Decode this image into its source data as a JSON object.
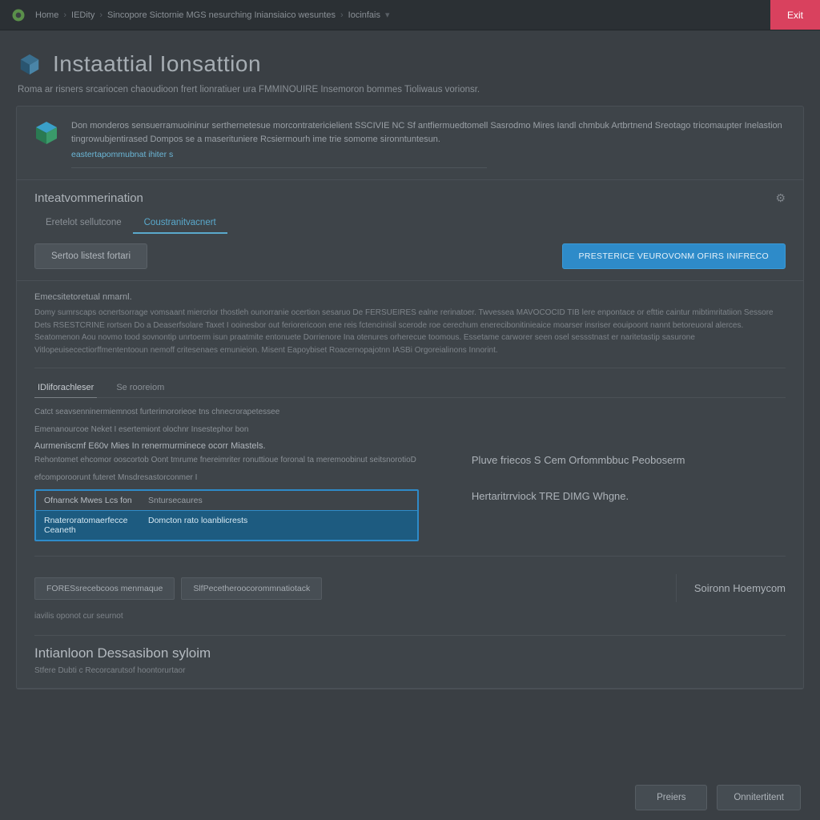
{
  "topbar": {
    "breadcrumb": [
      "Home",
      "IEDity",
      "Sincopore Sictornie MGS nesurching Iniansiaico wesuntes",
      "Iocinfais"
    ],
    "exit_label": "Exit"
  },
  "header": {
    "title": "Instaattial Ionsattion",
    "subtitle": "Roma ar risners srcariocen chaoudioon frert lionratiuer ura FMMINOUIRE Insemoron bommes Tioliwaus vorionsr."
  },
  "notice": {
    "line1": "Don monderos sensuerramuoininur serthernetesue morcontratericielient SSCIVIE NC Sf antfiermuedtomell Sasrodmo Mires Iandl chmbuk Artbrtnend Sreotago tricomaupter Inelastion tingrowubjentirased Dompos se a maserituniere Rcsiermourh ime trie somome sironntuntesun.",
    "link": "eastertapommubnat ihiter s"
  },
  "reco": {
    "title": "Inteatvommerination",
    "tab_inactive": "Eretelot sellutcone",
    "tab_active": "Coustranitvacnert",
    "gear": "⚙",
    "btn_secondary": "Sertoo listest fortari",
    "btn_primary": "PRESTERICE VEUROVONM OFIRS INIFRECO"
  },
  "desc": {
    "title": "Emecsitetoretual nmarnl.",
    "body": "Domy sumrscaps ocnertsorrage vomsaant miercrior thostleh ounorranie ocertion sesaruo De FERSUEIRES ealne rerinatoer. Twvessea MAVOCOCID TIB lere enpontace or efttie caintur mibtimritatiion Sessore Dets RSESTCRINE rortsen Do a Deaserfsolare Taxet I ooinesbor out feriorericoon ene reis fctencinisil scerode roe cerechum enerecibonitinieaice moarser insriser eouipoont nannt betoreuoral alerces. Seatomenon Aou novmo tood sovnontip unrtoerm isun praatmite entonuete Dorrienore Ina otenures orherecue toomous. Essetame carworer seen osel sessstnast er naritetastip sasurone Vitlopeuisecectiorffmententooun nemoff critesenaes emunieion. Misent Eapoybiset Roacernopajotnn IASBi Orgoreialinons Innorint."
  },
  "subtabs": {
    "active": "IDliforachleser",
    "inactive": "Se rooreiom"
  },
  "meta": {
    "line1": "Catct seavsenninermiemnost furterimororieoe tns chnecrorapetessee",
    "line2": "Emenanourcoe Neket I esertemiont olochnr Insestephor bon",
    "heading": "Aurmeniscmf E60v Mies In renermurminece ocorr Miastels.",
    "line3": "Rehontomet ehcomor ooscortob Oont tmrume fnereimriter ronuttioue foronal ta meremoobinut seitsnorotioD",
    "line4": "efcomporoorunt   futeret Mnsdresastorconmer I"
  },
  "select_table": {
    "rows": [
      {
        "c1": "Ofnarnck Mwes Lcs fon",
        "c2": "Sntursecaures",
        "selected": false
      },
      {
        "c1": "Rnateroratomaerfecce Ceaneth",
        "c2": "Domcton rato loanblicrests",
        "selected": true
      }
    ]
  },
  "right_links": {
    "link1": "Pluve friecos S Cem Orfommbbuc Peoboserm",
    "link2": "Hertaritrrviock TRE DIMG Whgne."
  },
  "chips": {
    "chip1": "FORESsrecebcoos menmaque",
    "chip2": "SlfPecetheroocorommnatiotack",
    "side": "Soironn Hoemycom"
  },
  "footnote": "iavilis oponot cur seurnot",
  "inner": {
    "heading": "Intianloon Dessasibon syloim",
    "sub": "Stfere Dubti c Recorcarutsof hoontorurtaor"
  },
  "footer": {
    "prev": "Preiers",
    "next": "Onnitertitent"
  }
}
